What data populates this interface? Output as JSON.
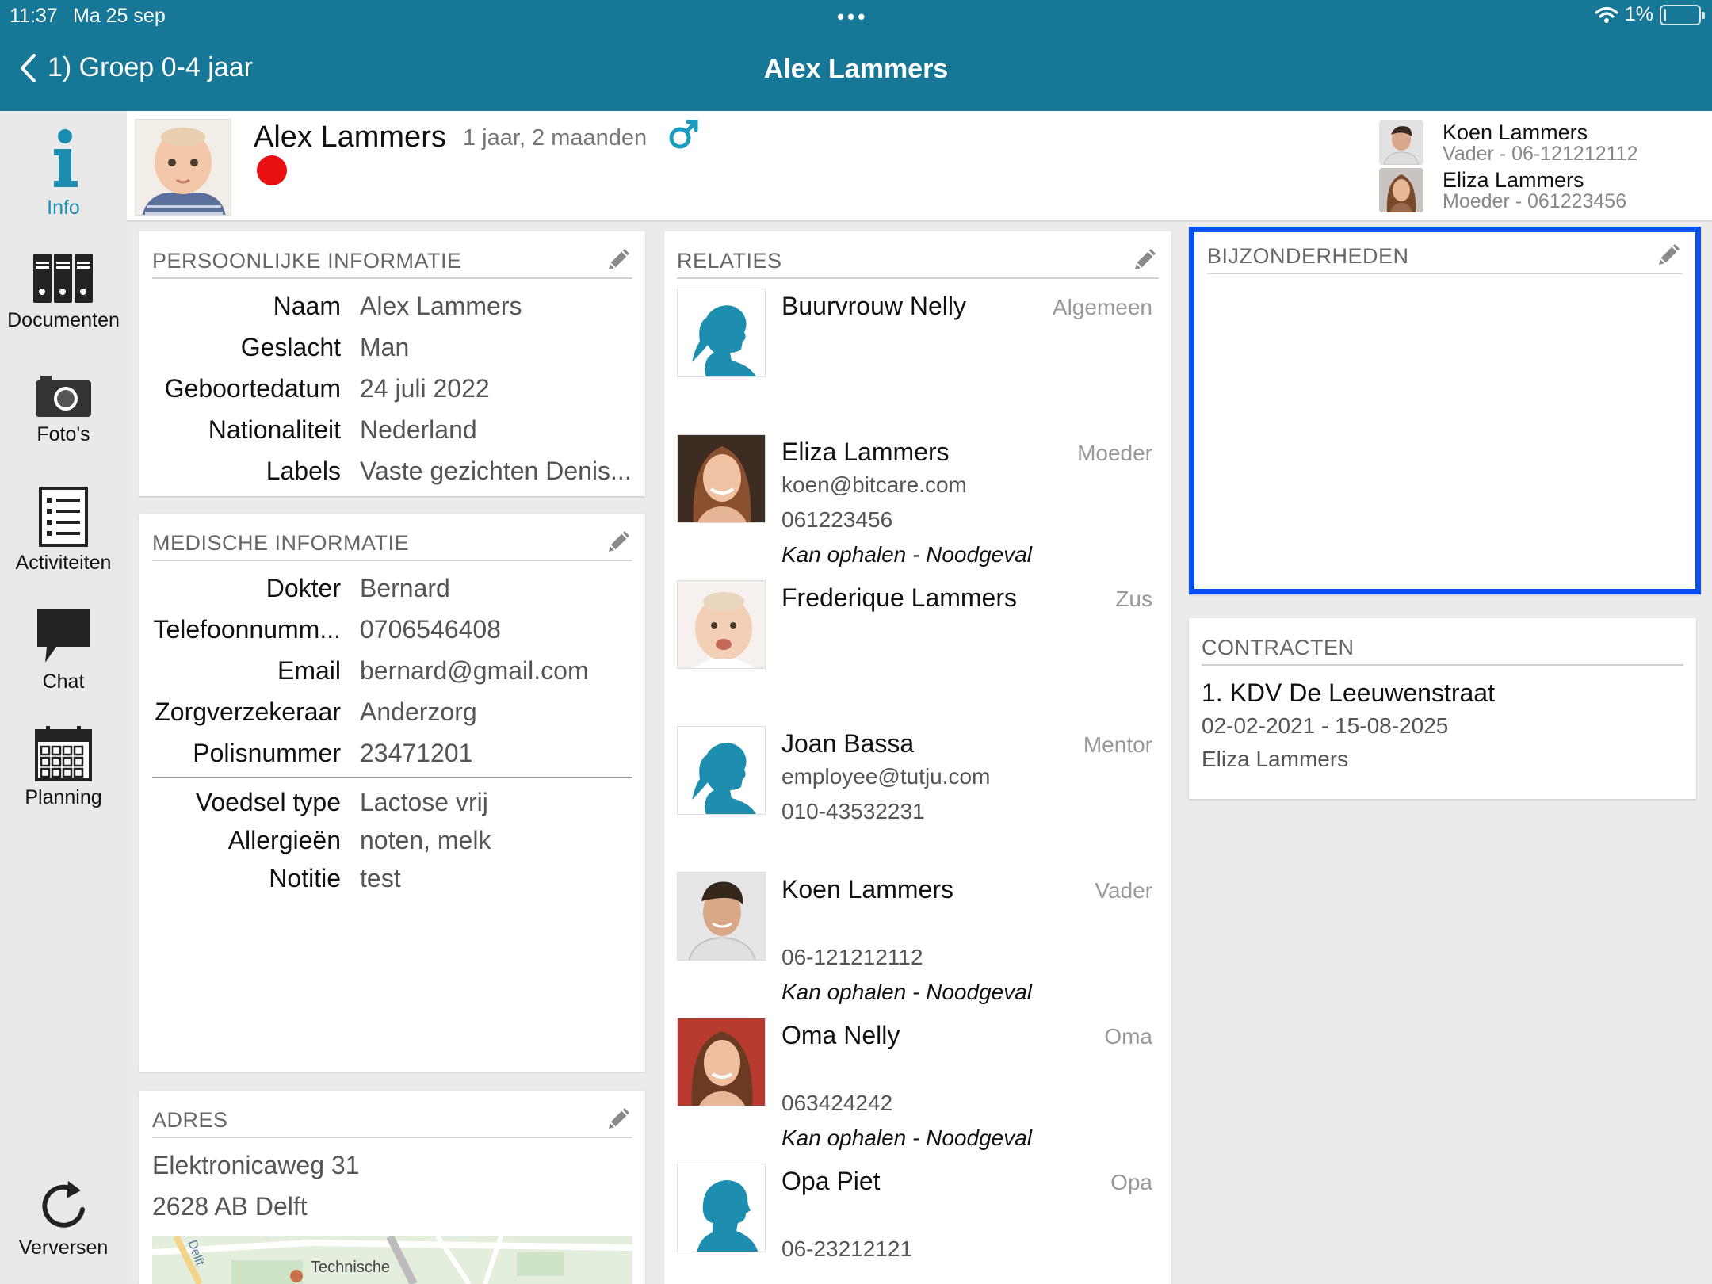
{
  "status_bar": {
    "time": "11:37",
    "date": "Ma 25 sep",
    "dots": "•••",
    "battery": "1%"
  },
  "nav": {
    "back_label": "1) Groep 0-4 jaar",
    "title": "Alex Lammers"
  },
  "sidebar": {
    "items": [
      {
        "label": "Info",
        "icon": "info-icon"
      },
      {
        "label": "Documenten",
        "icon": "binders-icon"
      },
      {
        "label": "Foto's",
        "icon": "camera-icon"
      },
      {
        "label": "Activiteiten",
        "icon": "list-icon"
      },
      {
        "label": "Chat",
        "icon": "chat-bubble-icon"
      },
      {
        "label": "Planning",
        "icon": "calendar-icon"
      }
    ],
    "refresh_label": "Verversen"
  },
  "child": {
    "name": "Alex Lammers",
    "age": "1 jaar, 2 maanden",
    "gender_icon": "male-symbol-icon",
    "status_color": "#e81010"
  },
  "parents": [
    {
      "name": "Koen Lammers",
      "detail": "Vader - 06-121212112"
    },
    {
      "name": "Eliza Lammers",
      "detail": "Moeder - 061223456"
    }
  ],
  "personal": {
    "title": "PERSOONLIJKE INFORMATIE",
    "rows": [
      {
        "key": "Naam",
        "value": "Alex Lammers"
      },
      {
        "key": "Geslacht",
        "value": "Man"
      },
      {
        "key": "Geboortedatum",
        "value": "24 juli 2022"
      },
      {
        "key": "Nationaliteit",
        "value": "Nederland"
      },
      {
        "key": "Labels",
        "value": "Vaste gezichten Denis..."
      }
    ]
  },
  "medical": {
    "title": "MEDISCHE INFORMATIE",
    "rows": [
      {
        "key": "Dokter",
        "value": "Bernard"
      },
      {
        "key": "Telefoonnumm...",
        "value": "0706546408"
      },
      {
        "key": "Email",
        "value": "bernard@gmail.com"
      },
      {
        "key": "Zorgverzekeraar",
        "value": "Anderzorg"
      },
      {
        "key": "Polisnummer",
        "value": "23471201"
      }
    ],
    "rows2": [
      {
        "key": "Voedsel type",
        "value": "Lactose vrij"
      },
      {
        "key": "Allergieën",
        "value": "noten, melk"
      },
      {
        "key": "Notitie",
        "value": "test"
      }
    ]
  },
  "address": {
    "title": "ADRES",
    "line1": "Elektronicaweg 31",
    "line2": "2628 AB Delft",
    "map_label": "Technische",
    "map_road": "Delft"
  },
  "relations": {
    "title": "RELATIES",
    "items": [
      {
        "name": "Buurvrouw Nelly",
        "role": "Algemeen",
        "l1": "",
        "l2": "",
        "l3": "",
        "photo": "silhouette-female"
      },
      {
        "name": "Eliza Lammers",
        "role": "Moeder",
        "l1": "koen@bitcare.com",
        "l2": "061223456",
        "l3": "Kan ophalen - Noodgeval",
        "photo": "woman"
      },
      {
        "name": "Frederique Lammers",
        "role": "Zus",
        "l1": "",
        "l2": "",
        "l3": "",
        "photo": "baby"
      },
      {
        "name": "Joan Bassa",
        "role": "Mentor",
        "l1": "employee@tutju.com",
        "l2": "010-43532231",
        "l3": "",
        "photo": "silhouette-female"
      },
      {
        "name": "Koen Lammers",
        "role": "Vader",
        "l1": "",
        "l2": "06-121212112",
        "l3": "Kan ophalen - Noodgeval",
        "photo": "man"
      },
      {
        "name": "Oma Nelly",
        "role": "Oma",
        "l1": "",
        "l2": "063424242",
        "l3": "Kan ophalen - Noodgeval",
        "photo": "woman2"
      },
      {
        "name": "Opa Piet",
        "role": "Opa",
        "l1": "",
        "l2": "06-23212121",
        "l3": "",
        "photo": "silhouette-male"
      }
    ]
  },
  "details": {
    "title": "BIJZONDERHEDEN",
    "highlight_color": "#0a4ff0"
  },
  "contracts": {
    "title": "CONTRACTEN",
    "name": "1. KDV De Leeuwenstraat",
    "period": "02-02-2021 - 15-08-2025",
    "person": "Eliza Lammers"
  },
  "colors": {
    "header": "#167797",
    "accent": "#1a8db0",
    "silhouette": "#1d8eb0"
  }
}
